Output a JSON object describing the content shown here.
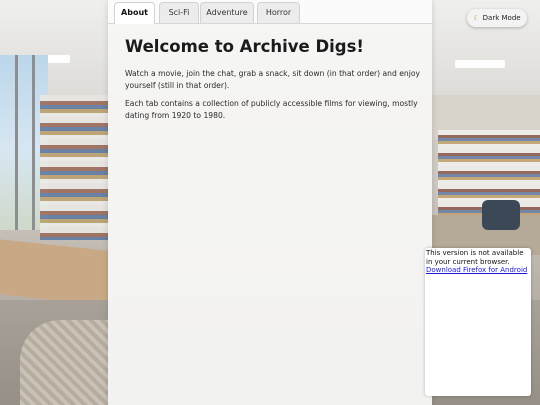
{
  "tabs": [
    {
      "label": "About",
      "active": true
    },
    {
      "label": "Sci-Fi",
      "active": false
    },
    {
      "label": "Adventure",
      "active": false
    },
    {
      "label": "Horror",
      "active": false
    }
  ],
  "main": {
    "title": "Welcome to Archive Digs!",
    "paragraphs": [
      "Watch a movie, join the chat, grab a snack, sit down (in that order) and enjoy yourself (still in that order).",
      "Each tab contains a collection of publicly accessible films for viewing, mostly dating from 1920 to 1980."
    ]
  },
  "dark_mode": {
    "label": "Dark Mode",
    "icon": "moon-icon"
  },
  "notice": {
    "text": "This version is not available in your current browser.",
    "link": "Download Firefox for Android"
  },
  "colors": {
    "link": "#1a1ad6",
    "moon": "#c99a2e"
  }
}
